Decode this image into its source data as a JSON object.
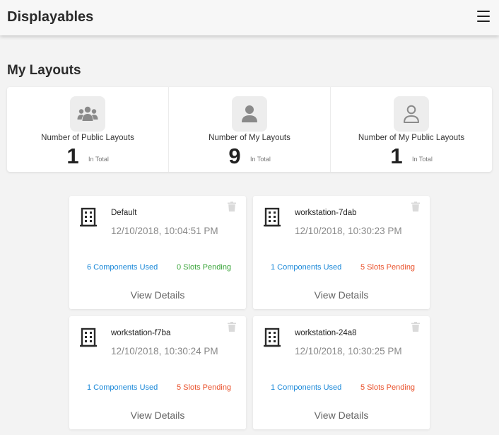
{
  "app": {
    "title": "Displayables"
  },
  "header": {
    "menu_icon": "hamburger-menu-icon"
  },
  "section": {
    "title": "My Layouts"
  },
  "stats": [
    {
      "label": "Number of Public Layouts",
      "value": "1",
      "unit": "In Total",
      "icon": "users-group-icon"
    },
    {
      "label": "Number of My Layouts",
      "value": "9",
      "unit": "In Total",
      "icon": "user-filled-icon"
    },
    {
      "label": "Number of My Public Layouts",
      "value": "1",
      "unit": "In Total",
      "icon": "user-outline-icon"
    }
  ],
  "layouts": [
    {
      "name": "Default",
      "date": "12/10/2018, 10:04:51 PM",
      "components": "6 Components Used",
      "slots": "0 Slots Pending",
      "slots_status": "ok",
      "details": "View Details"
    },
    {
      "name": "workstation-7dab",
      "date": "12/10/2018, 10:30:23 PM",
      "components": "1 Components Used",
      "slots": "5 Slots Pending",
      "slots_status": "pending",
      "details": "View Details"
    },
    {
      "name": "workstation-f7ba",
      "date": "12/10/2018, 10:30:24 PM",
      "components": "1 Components Used",
      "slots": "5 Slots Pending",
      "slots_status": "pending",
      "details": "View Details"
    },
    {
      "name": "workstation-24a8",
      "date": "12/10/2018, 10:30:25 PM",
      "components": "1 Components Used",
      "slots": "5 Slots Pending",
      "slots_status": "pending",
      "details": "View Details"
    }
  ],
  "colors": {
    "link_blue": "#1a88d8",
    "status_ok": "#3aa53a",
    "status_pending": "#e9502a",
    "icon_gray": "#8a8a8a"
  }
}
